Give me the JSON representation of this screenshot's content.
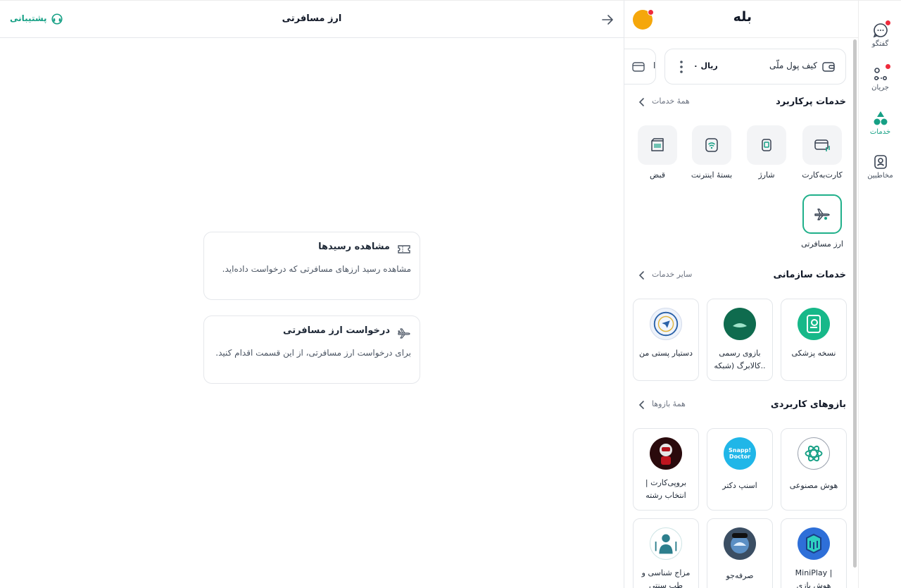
{
  "app": {
    "title": "بله"
  },
  "rail": {
    "items": [
      {
        "label": "گفتگو",
        "icon": "chat-icon",
        "badge": true
      },
      {
        "label": "جریان",
        "icon": "flow-icon",
        "badge": true
      },
      {
        "label": "خدمات",
        "icon": "services-icon",
        "active": true
      },
      {
        "label": "مخاطبین",
        "icon": "contacts-icon"
      }
    ]
  },
  "wallet": {
    "name": "کیف پول ملّی",
    "balance": "۰ ریال",
    "partial_card": "ا"
  },
  "frequent_services": {
    "title": "خدمات پرکاربرد",
    "link": "همهٔ خدمات",
    "items": [
      {
        "label": "کارت‌به‌کارت",
        "icon": "card-transfer-icon"
      },
      {
        "label": "شارژ",
        "icon": "sim-charge-icon"
      },
      {
        "label": "بستهٔ اینترنت",
        "icon": "wifi-icon"
      },
      {
        "label": "قبض",
        "icon": "bill-icon"
      },
      {
        "label": "ارز مسافرتی",
        "icon": "airplane-icon",
        "selected": true
      }
    ]
  },
  "org_services": {
    "title": "خدمات سازمانی",
    "link": "سایر خدمات",
    "items": [
      {
        "label": "نسخه پزشکی",
        "icon": "prescription-icon"
      },
      {
        "label": "بازوی رسمی کالابرگ (شبکه..",
        "icon": "kalabarg-logo"
      },
      {
        "label": "دستیار پستی من",
        "icon": "post-logo"
      }
    ]
  },
  "bots": {
    "title": "بازوهای کاربردی",
    "link": "همهٔ بازوها",
    "items": [
      {
        "label": "هوش مصنوعی",
        "icon": "ai-logo"
      },
      {
        "label": "اسنپ دکتر",
        "icon": "snapp-doctor-logo",
        "logo_text": "Snapp! Doctor"
      },
      {
        "label": "بروپی‌کارت | انتخاب رشته",
        "icon": "robot-logo"
      },
      {
        "label": "MiniPlay | هوش بازی",
        "icon": "miniplay-logo"
      },
      {
        "label": "صرفه‌جو",
        "icon": "sarfejoo-logo"
      },
      {
        "label": "مزاج شناسی و طب سنتی",
        "icon": "mezaj-logo"
      }
    ]
  },
  "main": {
    "title": "ارز مسافرتی",
    "support": "پشتیبانی",
    "options": [
      {
        "title": "مشاهده رسیدها",
        "desc": "مشاهده رسید ارزهای مسافرتی که درخواست داده‌اید.",
        "icon": "ticket-icon"
      },
      {
        "title": "درخواست ارز مسافرتی",
        "desc": "برای درخواست ارز مسافرتی، از این قسمت اقدام کنید.",
        "icon": "airplane-icon"
      }
    ]
  },
  "colors": {
    "accent": "#16a085",
    "badge": "#ef2b3c",
    "avatar": "#f5a70b"
  }
}
